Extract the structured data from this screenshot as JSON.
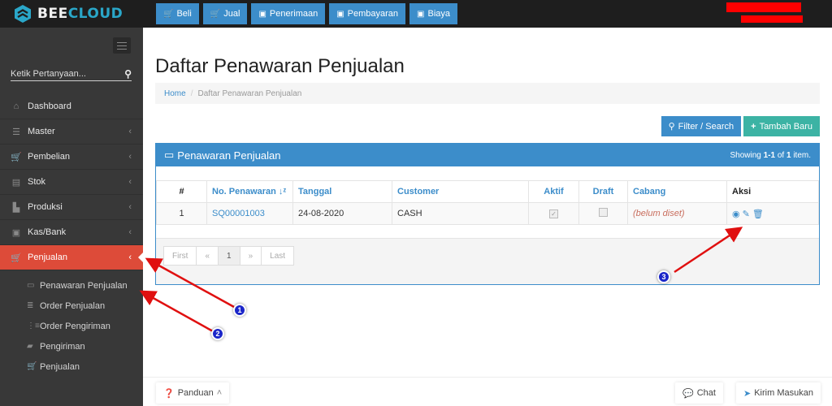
{
  "app": {
    "logo_left": "BEE",
    "logo_right": "CLOUD",
    "brand_color": "#2aa7c9"
  },
  "quick_nav": [
    {
      "label": "Beli",
      "icon": "cart-icon"
    },
    {
      "label": "Jual",
      "icon": "cart-icon"
    },
    {
      "label": "Penerimaan",
      "icon": "money-icon"
    },
    {
      "label": "Pembayaran",
      "icon": "money-icon"
    },
    {
      "label": "Biaya",
      "icon": "money-icon"
    }
  ],
  "sidebar": {
    "search_placeholder": "Ketik Pertanyaan...",
    "items": [
      {
        "label": "Dashboard",
        "icon": "home-icon"
      },
      {
        "label": "Master",
        "icon": "database-icon"
      },
      {
        "label": "Pembelian",
        "icon": "cart-icon"
      },
      {
        "label": "Stok",
        "icon": "archive-icon"
      },
      {
        "label": "Produksi",
        "icon": "factory-icon"
      },
      {
        "label": "Kas/Bank",
        "icon": "money-icon"
      },
      {
        "label": "Penjualan",
        "icon": "cart-icon",
        "active": true
      }
    ],
    "submenu": [
      {
        "label": "Penawaran Penjualan",
        "icon": "credit-card-icon"
      },
      {
        "label": "Order Penjualan",
        "icon": "list-icon"
      },
      {
        "label": "Order Pengiriman",
        "icon": "list-ol-icon"
      },
      {
        "label": "Pengiriman",
        "icon": "truck-icon"
      },
      {
        "label": "Penjualan",
        "icon": "cart-icon"
      }
    ]
  },
  "page": {
    "title": "Daftar Penawaran Penjualan",
    "breadcrumb": {
      "home": "Home",
      "sep": "/",
      "current": "Daftar Penawaran Penjualan"
    },
    "filter_label": "Filter / Search",
    "add_label": "Tambah Baru"
  },
  "panel": {
    "title": "Penawaran Penjualan",
    "summary_prefix": "Showing ",
    "summary_range": "1-1",
    "summary_mid": " of ",
    "summary_total": "1",
    "summary_suffix": " item.",
    "columns": [
      "#",
      "No. Penawaran",
      "Tanggal",
      "Customer",
      "Aktif",
      "Draft",
      "Cabang",
      "Aksi"
    ],
    "rows": [
      {
        "no": "1",
        "number": "SQ00001003",
        "date": "24-08-2020",
        "customer": "CASH",
        "aktif": true,
        "draft": false,
        "cabang": "(belum diset)"
      }
    ],
    "pager": [
      "First",
      "«",
      "1",
      "»",
      "Last"
    ]
  },
  "footer": {
    "guide_label": "Panduan",
    "chat_label": "Chat",
    "feedback_label": "Kirim Masukan"
  },
  "annotations": [
    "1",
    "2",
    "3"
  ],
  "colors": {
    "primary": "#3c8dca",
    "teal": "#3cb3a4",
    "active_menu": "#dd4b39",
    "sidebar": "#383838",
    "annotation_arrow": "#e01010",
    "annotation_badge": "#1b26c9"
  }
}
